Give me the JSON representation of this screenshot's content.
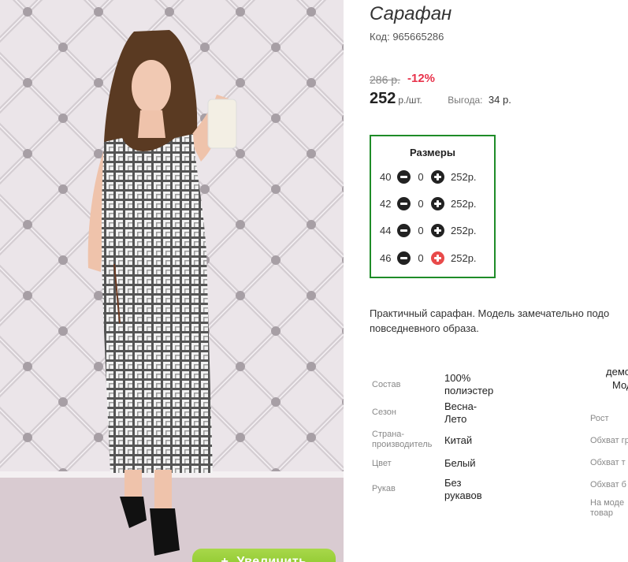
{
  "product": {
    "title": "Сарафан",
    "code": "Код: 965665286",
    "old_price": "286 р.",
    "discount": "-12%",
    "price": "252",
    "price_unit": "р./шт.",
    "benefit_label": "Выгода:",
    "benefit_value": "34 р."
  },
  "gallery": {
    "zoom_label": "Увеличить",
    "zoom_icon": "plus-icon"
  },
  "sizes": {
    "title": "Размеры",
    "rows": [
      {
        "size": "40",
        "qty": "0",
        "price": "252р."
      },
      {
        "size": "42",
        "qty": "0",
        "price": "252р."
      },
      {
        "size": "44",
        "qty": "0",
        "price": "252р."
      },
      {
        "size": "46",
        "qty": "0",
        "price": "252р."
      }
    ],
    "active_plus_color": "#e84a4a",
    "border_color": "#1e8c28"
  },
  "description": {
    "line1": "Практичный сарафан. Модель замечательно подо",
    "line2": "повседневного образа."
  },
  "attributes": [
    {
      "label": "Состав",
      "value_l1": "100%",
      "value_l2": "полиэстер"
    },
    {
      "label": "Сезон",
      "value_l1": "Весна-",
      "value_l2": "Лето"
    },
    {
      "label_l1": "Страна-",
      "label_l2": "производитель",
      "value": "Китай"
    },
    {
      "label": "Цвет",
      "value": "Белый"
    },
    {
      "label": "Рукав",
      "value_l1": "Без",
      "value_l2": "рукавов"
    }
  ],
  "side_attributes": {
    "value_top_l1": "демо",
    "value_top_l2": "Мод",
    "rost": "Рост",
    "obhvat1": "Обхват гр",
    "obhvat2": "Обхват т",
    "obhvat3": "Обхват б",
    "model_l1": "На моде",
    "model_l2": "товар"
  }
}
